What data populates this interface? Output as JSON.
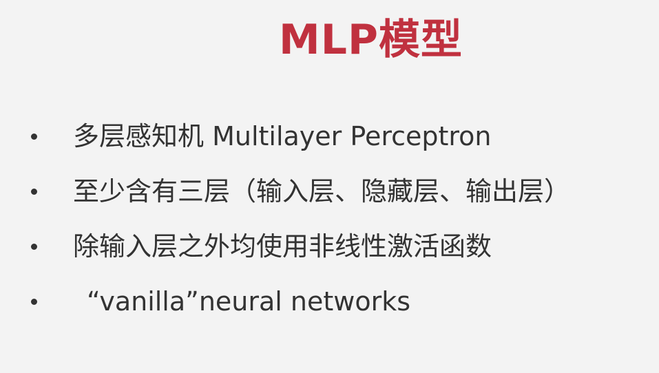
{
  "slide": {
    "title": "MLP模型",
    "bullets": [
      {
        "text": "多层感知机 Multilayer Perceptron"
      },
      {
        "text": "至少含有三层（输入层、隐藏层、输出层）"
      },
      {
        "text": "除输入层之外均使用非线性激活函数"
      },
      {
        "text": "“vanilla”neural networks"
      }
    ]
  },
  "colors": {
    "title": "#c0313f",
    "body_text": "#333333",
    "background": "#f3f3f3"
  }
}
